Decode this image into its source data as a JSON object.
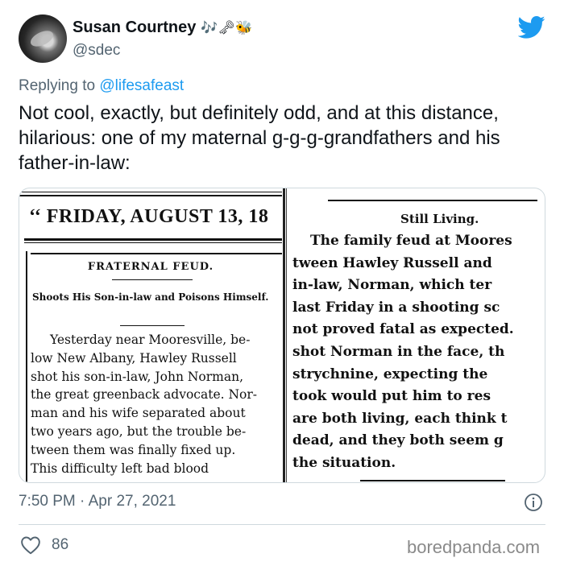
{
  "author": {
    "display_name": "Susan Courtney",
    "emoji": "🎶🗝🐝",
    "handle": "@sdec"
  },
  "reply": {
    "prefix": "Replying to ",
    "to": "@lifesafeast"
  },
  "tweet_text": "Not cool, exactly, but definitely odd, and at this distance, hilarious: one of my maternal g-g-g-grandfathers and his father-in-law:",
  "clipping_left": {
    "date_line": "‘‘ FRIDAY, AUGUST 13, 18",
    "headline": "FRATERNAL FEUD.",
    "subhead": "Shoots His Son-in-law and Poisons Himself.",
    "lines": [
      "Yesterday near Mooresville, be-",
      "low New Albany, Hawley Russell",
      "shot his son-in-law, John Norman,",
      "the great greenback advocate. Nor-",
      "man and his wife separated about",
      "two years ago, but the trouble be-",
      "tween them was finally fixed up.",
      "This difficulty left bad blood"
    ]
  },
  "clipping_right": {
    "title": "Still Living.",
    "lines": [
      "The family feud at Moores",
      "tween Hawley Russell and",
      "in-law, Norman, which ter",
      "last Friday in a shooting sc",
      "not proved fatal as expected.",
      "shot Norman in the face, th",
      "strychnine, expecting the",
      "took would put him to res",
      "are both living, each think t",
      "dead, and they both seem g",
      "the situation."
    ]
  },
  "footer": {
    "timestamp": "7:50 PM · Apr 27, 2021",
    "likes": "86",
    "watermark": "boredpanda.com"
  },
  "colors": {
    "text": "#0f1419",
    "secondary": "#536471",
    "link": "#1d9bf0",
    "twitter_blue": "#1d9bf0",
    "border": "#cfd9de"
  },
  "icons": {
    "brand": "twitter-bird-icon",
    "info": "info-icon",
    "like": "heart-icon"
  }
}
